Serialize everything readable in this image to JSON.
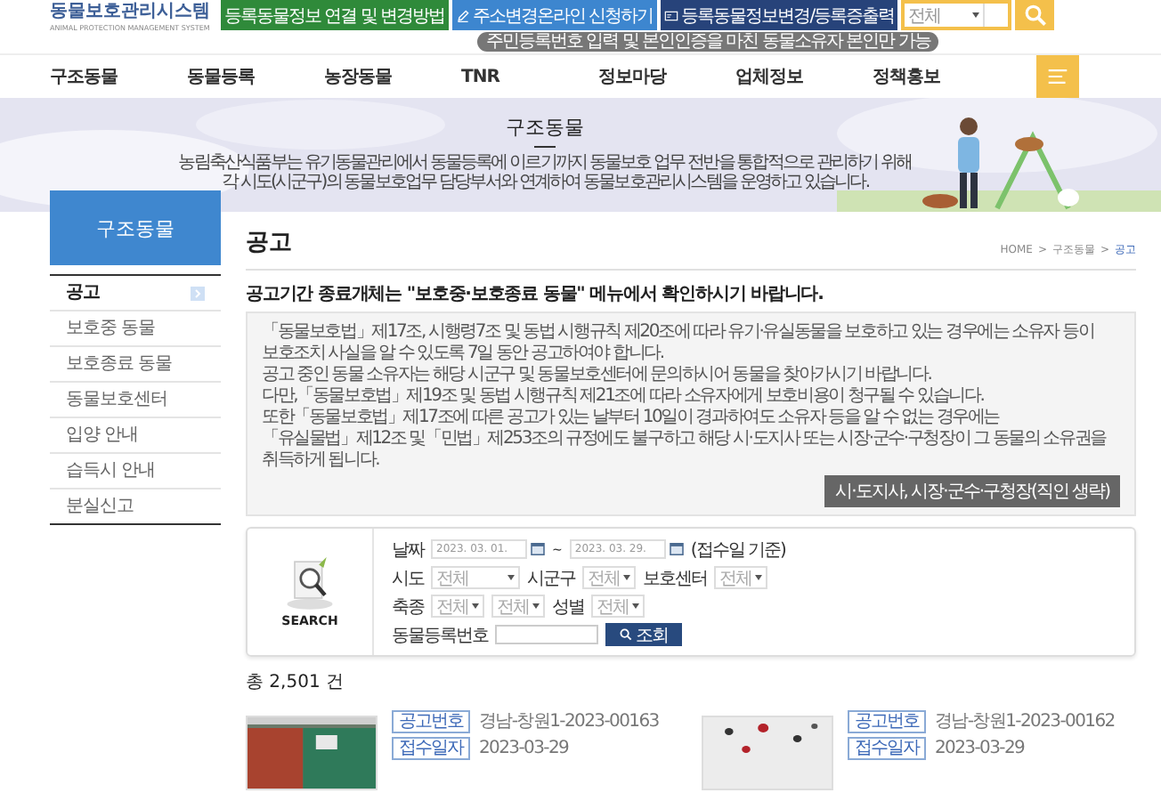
{
  "header": {
    "logo": {
      "title": "동물보호관리시스템",
      "subtitle": "ANIMAL PROTECTION MANAGEMENT SYSTEM"
    },
    "quick_links": [
      {
        "label": "등록동물정보 연결 및 변경방법",
        "kind": "plain"
      },
      {
        "label": "주소변경온라인 신청하기",
        "kind": "pencil"
      },
      {
        "label": "등록동물정보변경/등록증출력",
        "kind": "card"
      }
    ],
    "tooltip": "주민등록번호 입력 및 본인인증을 마친 동물소유자 본인만 가능",
    "search": {
      "scope": "전체"
    }
  },
  "nav": {
    "items": [
      "구조동물",
      "동물등록",
      "농장동물",
      "TNR",
      "정보마당",
      "업체정보",
      "정책홍보"
    ]
  },
  "banner": {
    "title": "구조동물",
    "description": [
      "농림축산식품부는 유기동물관리에서 동물등록에 이르기까지 동물보호 업무 전반을 통합적으로 관리하기 위해",
      "각 시도(시군구)의 동물보호업무 담당부서와 연계하여 동물보호관리시스템을 운영하고 있습니다."
    ]
  },
  "sidebar": {
    "title": "구조동물",
    "items": [
      {
        "label": "공고",
        "selected": true
      },
      {
        "label": "보호중 동물",
        "selected": false
      },
      {
        "label": "보호종료 동물",
        "selected": false
      },
      {
        "label": "동물보호센터",
        "selected": false
      },
      {
        "label": "입양 안내",
        "selected": false
      },
      {
        "label": "습득시 안내",
        "selected": false
      },
      {
        "label": "분실신고",
        "selected": false
      }
    ]
  },
  "page": {
    "title": "공고",
    "breadcrumb": [
      "HOME",
      "구조동물",
      "공고"
    ],
    "breadcrumb_separator": ">"
  },
  "notice": {
    "headline": "공고기간 종료개체는 **\"보호중·보호종료 동물\" 메뉴에서 확인**하시기 바랍니다.",
    "lines": [
      "「동물보호법」제17조, 시행령7조 및 동법 시행규칙 제20조에 따라 유기·유실동물을 보호하고 있는 경우에는 소유자 등이",
      "보호조치 사실을 알 수 있도록 7일 동안 공고하여야 합니다.",
      "공고 중인 동물 소유자는 해당 시군구 및 동물보호센터에 문의하시어 동물을 찾아가시기 바랍니다.",
      "다만,「동물보호법」제19조 및 동법 시행규칙 제21조에 따라 소유자에게 보호비용이 청구될 수 있습니다.",
      "또한「동물보호법」제17조에 따른 공고가 있는 날부터 10일이 경과하여도 소유자 등을 알 수 없는 경우에는",
      "「유실물법」제12조 및「민법」제253조의 규정에도 불구하고 해당 시·도지사 또는 시장·군수·구청장이 그 동물의 소유권을 취득하게 됩니다."
    ],
    "button": "시·도지사, 시장·군수·구청장(직인 생략)"
  },
  "search_panel": {
    "label": "SEARCH",
    "date_label": "날짜",
    "date_from": "2023. 03. 01.",
    "date_separator": "~",
    "date_to": "2023. 03. 29.",
    "date_note": "(접수일 기준)",
    "select_rows": [
      [
        {
          "label": "시도",
          "value": "전체"
        },
        {
          "label": "시군구",
          "value": "전체"
        },
        {
          "label": "보호센터",
          "value": "전체"
        }
      ],
      [
        {
          "label": "축종",
          "value": "전체"
        },
        {
          "value": "전체"
        },
        {
          "label": "성별",
          "value": "전체"
        }
      ]
    ],
    "reg_label": "동물등록번호",
    "submit": "조회"
  },
  "total": "총 2,501 건",
  "cards": [
    {
      "fields": [
        {
          "tag": "공고번호",
          "value": "경남-창원1-2023-00163"
        },
        {
          "tag": "접수일자",
          "value": "2023-03-29"
        }
      ]
    },
    {
      "fields": [
        {
          "tag": "공고번호",
          "value": "경남-창원1-2023-00162"
        },
        {
          "tag": "접수일자",
          "value": "2023-03-29"
        }
      ]
    }
  ]
}
